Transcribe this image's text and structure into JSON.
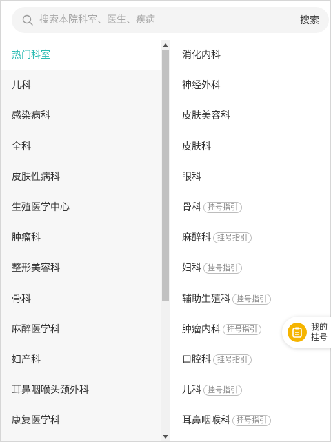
{
  "search": {
    "placeholder": "搜索本院科室、医生、疾病",
    "button_label": "搜索"
  },
  "departments": [
    {
      "label": "热门科室",
      "active": true
    },
    {
      "label": "儿科"
    },
    {
      "label": "感染病科"
    },
    {
      "label": "全科"
    },
    {
      "label": "皮肤性病科"
    },
    {
      "label": "生殖医学中心"
    },
    {
      "label": "肿瘤科"
    },
    {
      "label": "整形美容科"
    },
    {
      "label": "骨科"
    },
    {
      "label": "麻醉医学科"
    },
    {
      "label": "妇产科"
    },
    {
      "label": "耳鼻咽喉头颈外科"
    },
    {
      "label": "康复医学科"
    }
  ],
  "sub_departments": [
    {
      "label": "消化内科",
      "badge": ""
    },
    {
      "label": "神经外科",
      "badge": ""
    },
    {
      "label": "皮肤美容科",
      "badge": ""
    },
    {
      "label": "皮肤科",
      "badge": ""
    },
    {
      "label": "眼科",
      "badge": ""
    },
    {
      "label": "骨科",
      "badge": "挂号指引"
    },
    {
      "label": "麻醉科",
      "badge": "挂号指引"
    },
    {
      "label": "妇科",
      "badge": "挂号指引"
    },
    {
      "label": "辅助生殖科",
      "badge": "挂号指引"
    },
    {
      "label": "肿瘤内科",
      "badge": "挂号指引"
    },
    {
      "label": "口腔科",
      "badge": "挂号指引"
    },
    {
      "label": "儿科",
      "badge": "挂号指引"
    },
    {
      "label": "耳鼻咽喉科",
      "badge": "挂号指引"
    }
  ],
  "floating_button": {
    "label": "我的挂号"
  },
  "colors": {
    "accent": "#2bbbb3",
    "float_icon": "#f5b400"
  }
}
